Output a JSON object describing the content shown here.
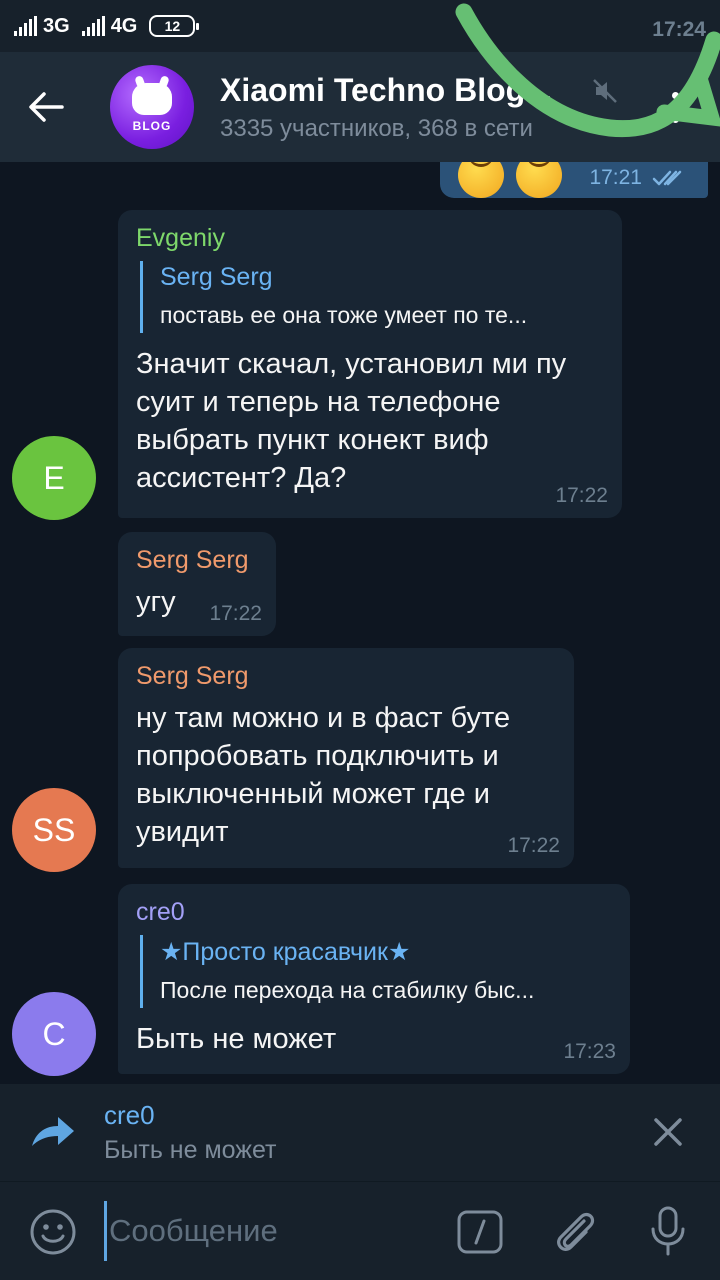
{
  "status_bar": {
    "time": "17:24",
    "network1": "3G",
    "network2": "4G",
    "battery": "12"
  },
  "header": {
    "title": "Xiaomi Techno Blog...",
    "subtitle": "3335 участников, 368 в сети",
    "avatar_text": "BLOG"
  },
  "outgoing": {
    "time": "17:21"
  },
  "messages": [
    {
      "sender": "Evgeniy",
      "sender_color": "#7ed86b",
      "reply_name": "Serg Serg",
      "reply_text": "поставь ее она тоже умеет по те...",
      "text": "Значит скачал, установил ми пу суит и теперь на телефоне выбрать пункт конект виф ассистент? Да?",
      "time": "17:22",
      "avatar_initials": "E",
      "avatar_color": "#6ac43f"
    },
    {
      "sender": "Serg Serg",
      "sender_color": "#f09a6c",
      "text": "угу",
      "time": "17:22"
    },
    {
      "sender": "Serg Serg",
      "sender_color": "#f09a6c",
      "text": "ну там можно и в фаст буте попробовать подключить и выключенный может где и увидит",
      "time": "17:22",
      "avatar_initials": "SS",
      "avatar_color": "#e57951"
    },
    {
      "sender": "cre0",
      "sender_color": "#a3a0f7",
      "reply_name": "★Просто красавчик★",
      "reply_text": "После перехода на стабилку быс...",
      "text": "Быть не может",
      "time": "17:23",
      "avatar_initials": "C",
      "avatar_color": "#8b7bed"
    }
  ],
  "reply_bar": {
    "name": "cre0",
    "text": "Быть не может"
  },
  "input": {
    "placeholder": "Сообщение"
  }
}
